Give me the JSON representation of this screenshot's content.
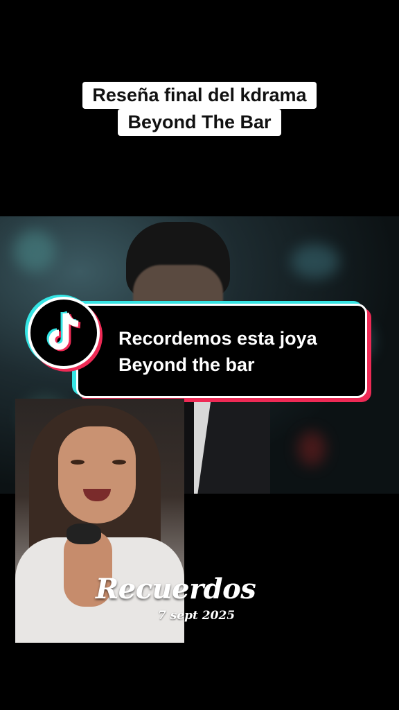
{
  "title_caption": {
    "line1": "Reseña final del kdrama",
    "line2": "Beyond The Bar"
  },
  "banner": {
    "line1": "Recordemos esta joya",
    "line2": "Beyond the bar",
    "logo_icon": "tiktok-logo-icon",
    "accent_cyan": "#35e4e4",
    "accent_red": "#ee2a55"
  },
  "overlay": {
    "title": "Recuerdos",
    "date": "7 sept 2025"
  }
}
